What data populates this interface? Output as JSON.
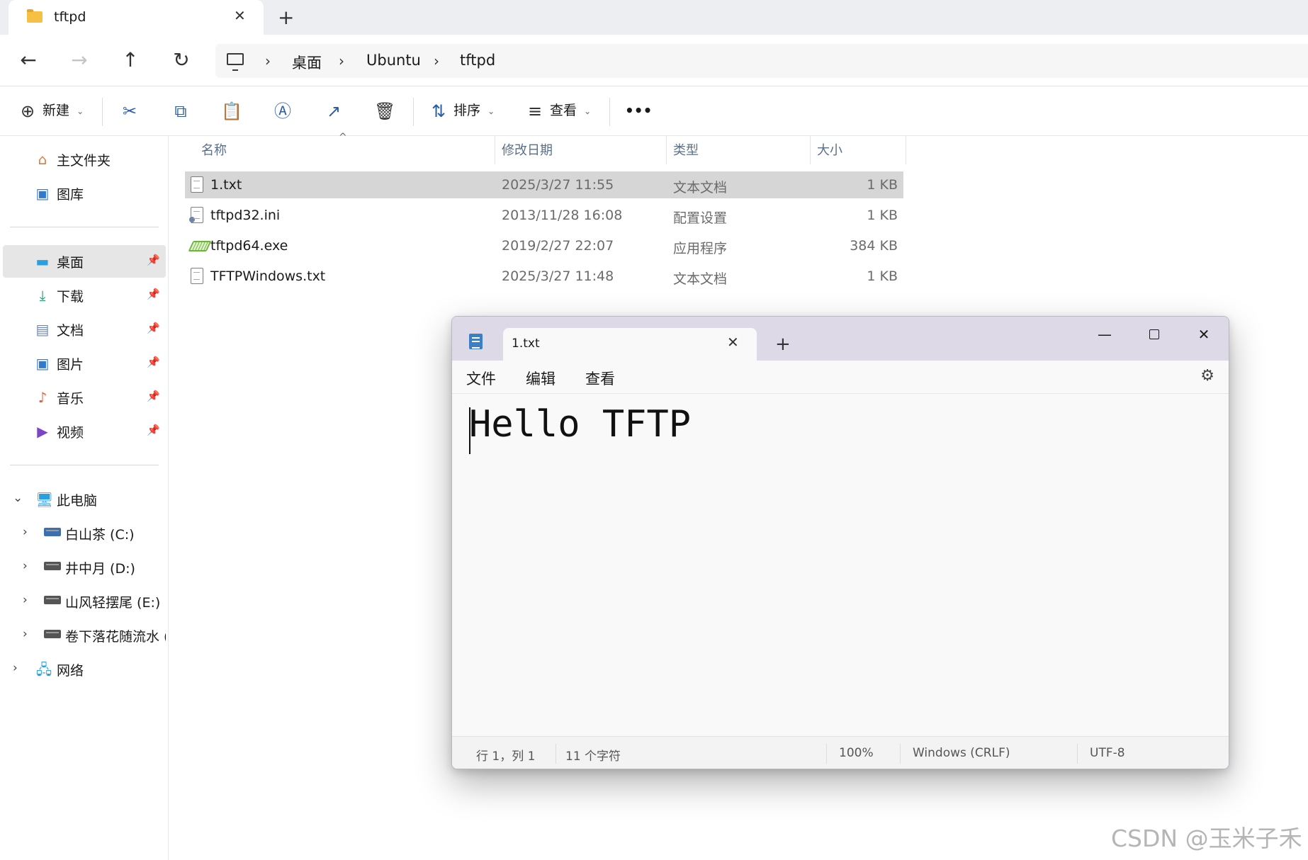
{
  "explorer": {
    "tab_title": "tftpd",
    "tab_close": "✕",
    "new_tab": "+",
    "nav": {
      "back": "←",
      "forward": "→",
      "up": "↑",
      "refresh": "↻"
    },
    "breadcrumb": {
      "sep": "›",
      "items": [
        "桌面",
        "Ubuntu",
        "tftpd"
      ]
    },
    "commands": {
      "new": "新建",
      "sort": "排序",
      "view": "查看",
      "more": "•••"
    },
    "sidebar": {
      "home": "主文件夹",
      "gallery": "图库",
      "quick": [
        "桌面",
        "下载",
        "文档",
        "图片",
        "音乐",
        "视频"
      ],
      "this_pc": "此电脑",
      "drives": [
        "白山茶 (C:)",
        "井中月 (D:)",
        "山风轻摆尾 (E:)",
        "卷下落花随流水 (F"
      ],
      "network": "网络"
    },
    "columns": {
      "name": "名称",
      "modified": "修改日期",
      "type": "类型",
      "size": "大小"
    },
    "files": [
      {
        "name": "1.txt",
        "modified": "2025/3/27 11:55",
        "type": "文本文档",
        "size": "1 KB",
        "icon": "text-file-icon",
        "selected": true
      },
      {
        "name": "tftpd32.ini",
        "modified": "2013/11/28 16:08",
        "type": "配置设置",
        "size": "1 KB",
        "icon": "ini-file-icon",
        "selected": false
      },
      {
        "name": "tftpd64.exe",
        "modified": "2019/2/27 22:07",
        "type": "应用程序",
        "size": "384 KB",
        "icon": "exe-file-icon",
        "selected": false
      },
      {
        "name": "TFTPWindows.txt",
        "modified": "2025/3/27 11:48",
        "type": "文本文档",
        "size": "1 KB",
        "icon": "text-file-icon",
        "selected": false
      }
    ]
  },
  "notepad": {
    "tab_title": "1.txt",
    "tab_close": "✕",
    "new_tab": "+",
    "window_controls": {
      "minimize": "—",
      "close": "✕"
    },
    "menu": [
      "文件",
      "编辑",
      "查看"
    ],
    "content": "Hello TFTP",
    "status": {
      "position": "行 1，列 1",
      "chars": "11 个字符",
      "zoom": "100%",
      "line_ending": "Windows (CRLF)",
      "encoding": "UTF-8"
    }
  },
  "watermark": "CSDN @玉米子禾",
  "colors": {
    "accent": "#2a5ea8",
    "selected_row": "#d6d6d6",
    "notepad_titlebar": "#ded9e6"
  }
}
